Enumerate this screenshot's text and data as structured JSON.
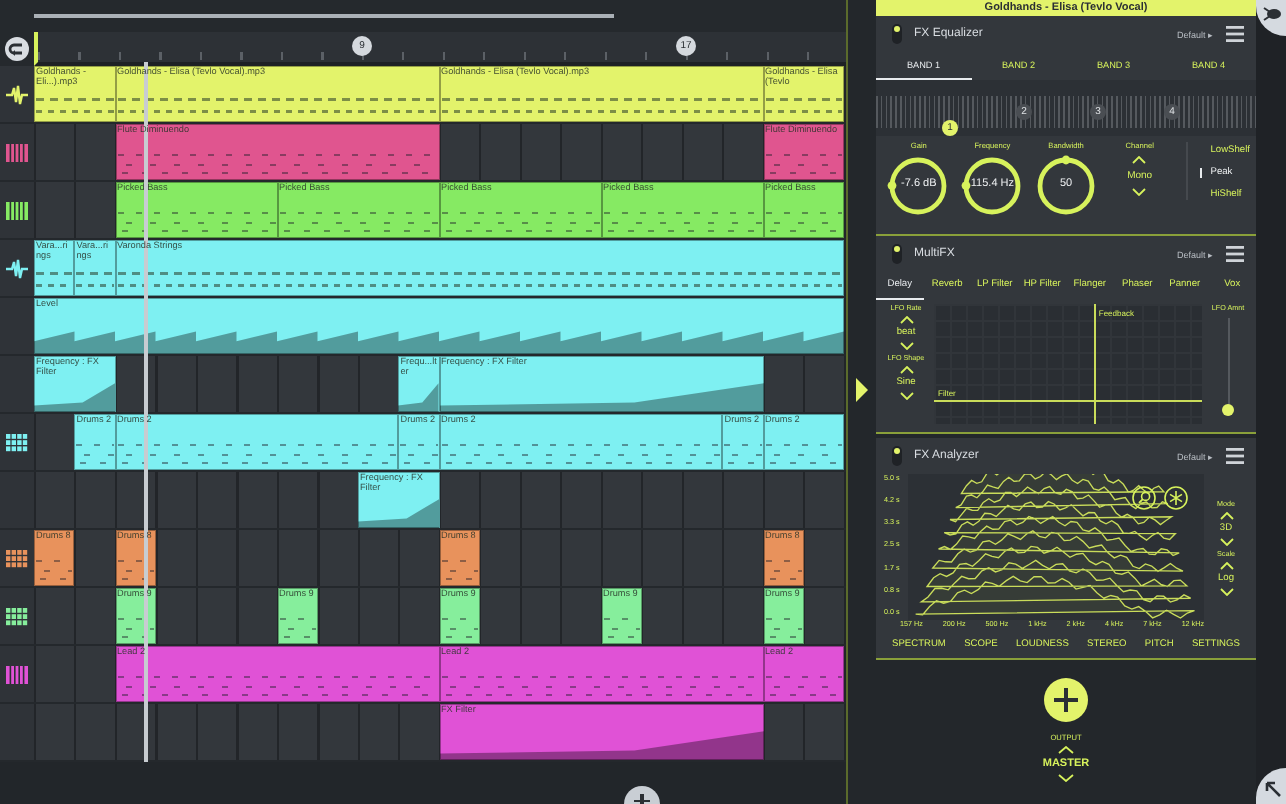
{
  "ruler": {
    "markers": [
      "9",
      "17"
    ]
  },
  "tracks": [
    {
      "kind": "audio",
      "color": "#e3f36b",
      "clips": [
        "Goldhands - Eli...).mp3",
        "Goldhands - Elisa (Tevlo Vocal).mp3",
        "Goldhands - Elisa (Tevlo Vocal).mp3",
        "Goldhands - Elisa (Tevlo"
      ]
    },
    {
      "kind": "instrument",
      "color": "#e0558f",
      "clips": [
        "Flute Diminuendo",
        "Flute Diminuendo"
      ]
    },
    {
      "kind": "instrument",
      "color": "#86ea63",
      "clips": [
        "Picked Bass",
        "Picked Bass",
        "Picked Bass",
        "Picked Bass",
        "Picked Bass"
      ]
    },
    {
      "kind": "audio",
      "color": "#7ef0f2",
      "clips": [
        "Vara...rings",
        "Vara...rings",
        "Varonda Strings"
      ]
    },
    {
      "kind": "automation",
      "color": "#7ef0f2",
      "clips": [
        "Level"
      ]
    },
    {
      "kind": "automation",
      "color": "#7ef0f2",
      "clips": [
        "Frequency : FX Filter",
        "Frequ...lter",
        "Frequency : FX Filter"
      ]
    },
    {
      "kind": "drums",
      "color": "#7ef0f2",
      "clips": [
        "Drums 2",
        "Drums 2",
        "Drums 2",
        "Drums 2",
        "Drums 2",
        "Drums 2"
      ]
    },
    {
      "kind": "automation",
      "color": "#7ef0f2",
      "clips": [
        "Frequency : FX Filter"
      ]
    },
    {
      "kind": "drums",
      "color": "#e8925c",
      "clips": [
        "Drums 8",
        "Drums 8",
        "Drums 8",
        "Drums 8"
      ]
    },
    {
      "kind": "drums",
      "color": "#86ee9c",
      "clips": [
        "Drums 9",
        "Drums 9",
        "Drums 9",
        "Drums 9",
        "Drums 9"
      ]
    },
    {
      "kind": "instrument",
      "color": "#e052d6",
      "clips": [
        "Lead 2",
        "Lead 2",
        "Lead 2"
      ]
    },
    {
      "kind": "automation",
      "color": "#e052d6",
      "clips": [
        "FX Filter"
      ]
    }
  ],
  "fx_title": "Goldhands - Elisa (Tevlo Vocal)",
  "equalizer": {
    "title": "FX Equalizer",
    "enabled": true,
    "preset": "Default ▸",
    "tabs": [
      {
        "label": "BAND 1",
        "selected": true
      },
      {
        "label": "BAND 2",
        "selected": false
      },
      {
        "label": "BAND 3",
        "selected": false
      },
      {
        "label": "BAND 4",
        "selected": false
      }
    ],
    "band_nodes": [
      {
        "label": "1",
        "selected": true
      },
      {
        "label": "2",
        "selected": false
      },
      {
        "label": "3",
        "selected": false
      },
      {
        "label": "4",
        "selected": false
      }
    ],
    "knobs": [
      {
        "label": "Gain",
        "value": "-7.6 dB",
        "level": 0.17
      },
      {
        "label": "Frequency",
        "value": "115.4 Hz",
        "level": 0.17
      },
      {
        "label": "Bandwidth",
        "value": "50",
        "level": 0.5
      }
    ],
    "channel": {
      "label": "Channel",
      "value": "Mono"
    },
    "filter_types": [
      {
        "label": "LowShelf",
        "selected": false
      },
      {
        "label": "Peak",
        "selected": true
      },
      {
        "label": "HiShelf",
        "selected": false
      }
    ]
  },
  "multifx": {
    "title": "MultiFX",
    "enabled": true,
    "preset": "Default ▸",
    "tabs": [
      {
        "label": "Delay",
        "selected": true
      },
      {
        "label": "Reverb",
        "selected": false
      },
      {
        "label": "LP Filter",
        "selected": false
      },
      {
        "label": "HP Filter",
        "selected": false
      },
      {
        "label": "Flanger",
        "selected": false
      },
      {
        "label": "Phaser",
        "selected": false
      },
      {
        "label": "Panner",
        "selected": false
      },
      {
        "label": "Vox",
        "selected": false
      }
    ],
    "lfo": [
      {
        "label": "LFO Rate",
        "value": "beat"
      },
      {
        "label": "LFO Shape",
        "value": "Sine"
      }
    ],
    "pad": {
      "y_label": "Feedback",
      "x_label": "Filter"
    },
    "amount": {
      "label": "LFO Amnt",
      "level": 0.06
    }
  },
  "analyzer": {
    "title": "FX Analyzer",
    "enabled": true,
    "preset": "Default ▸",
    "y_ticks": [
      "5.0 s",
      "4.2 s",
      "3.3 s",
      "2.5 s",
      "1.7 s",
      "0.8 s",
      "0.0 s"
    ],
    "x_ticks": [
      "157 Hz",
      "200 Hz",
      "500 Hz",
      "1 kHz",
      "2 kHz",
      "4 kHz",
      "7 kHz",
      "12 kHz"
    ],
    "controls": [
      {
        "label": "Mode",
        "value": "3D"
      },
      {
        "label": "Scale",
        "value": "Log"
      }
    ],
    "tabs": [
      "SPECTRUM",
      "SCOPE",
      "LOUDNESS",
      "STEREO",
      "PITCH",
      "SETTINGS"
    ]
  },
  "output": {
    "label": "OUTPUT",
    "value": "MASTER"
  }
}
